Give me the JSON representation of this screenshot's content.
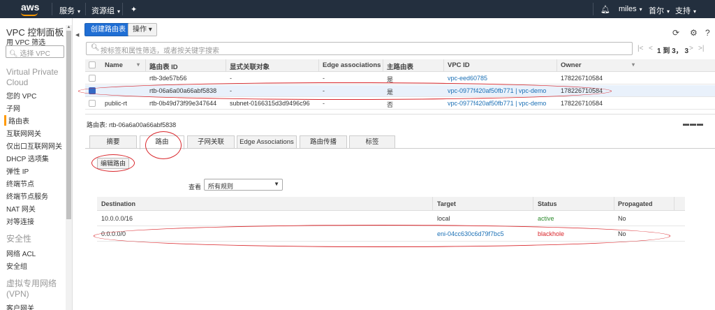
{
  "topnav": {
    "logo": "aws",
    "services": "服务",
    "resource_groups": "资源组",
    "user": "miles",
    "region": "首尔",
    "support": "支持"
  },
  "sidebar": {
    "title": "VPC 控制面板",
    "filter_label": "用 VPC 筛选",
    "filter_placeholder": "选择 VPC",
    "section_vpc": "Virtual Private Cloud",
    "items_vpc": [
      "您的 VPC",
      "子网",
      "路由表",
      "互联网网关",
      "仅出口互联网网关",
      "DHCP 选项集",
      "弹性 IP",
      "终端节点",
      "终端节点服务",
      "NAT 网关",
      "对等连接"
    ],
    "section_security": "安全性",
    "items_security": [
      "网络 ACL",
      "安全组"
    ],
    "section_vpn": "虚拟专用网络 (VPN)",
    "items_vpn": [
      "客户网关"
    ]
  },
  "toolbar": {
    "create_label": "创建路由表",
    "actions_label": "操作"
  },
  "search": {
    "placeholder": "按标签和属性筛选，或者按关键字搜索",
    "pager_text": "1 到 3， 3"
  },
  "route_tables": {
    "columns": [
      "Name",
      "路由表 ID",
      "显式关联对象",
      "Edge associations",
      "主路由表",
      "VPC ID",
      "Owner"
    ],
    "rows": [
      {
        "name": "",
        "id": "rtb-3de57b56",
        "explicit": "-",
        "edge": "-",
        "main": "是",
        "vpc": "vpc-eed60785",
        "owner": "178226710584",
        "selected": false
      },
      {
        "name": "",
        "id": "rtb-06a6a00a66abf5838",
        "explicit": "-",
        "edge": "-",
        "main": "是",
        "vpc": "vpc-0977f420af50fb771 | vpc-demo",
        "owner": "178226710584",
        "selected": true
      },
      {
        "name": "public-rt",
        "id": "rtb-0b49d73f99e347644",
        "explicit": "subnet-0166315d3d9496c96",
        "edge": "-",
        "main": "否",
        "vpc": "vpc-0977f420af50fb771 | vpc-demo",
        "owner": "178226710584",
        "selected": false
      }
    ]
  },
  "detail": {
    "title_label": "路由表:",
    "title_value": "rtb-06a6a00a66abf5838",
    "tabs": [
      "摘要",
      "路由",
      "子网关联",
      "Edge Associations",
      "路由传播",
      "标签"
    ],
    "active_tab": "路由",
    "edit_routes_label": "编辑路由",
    "view_label": "查看",
    "view_value": "所有规则"
  },
  "routes": {
    "columns": [
      "Destination",
      "Target",
      "Status",
      "Propagated"
    ],
    "rows": [
      {
        "destination": "10.0.0.0/16",
        "target": "local",
        "status": "active",
        "propagated": "No"
      },
      {
        "destination": "0.0.0.0/0",
        "target": "eni-04cc630c6d79f7bc5",
        "status": "blackhole",
        "propagated": "No"
      }
    ]
  },
  "colors": {
    "nav_bg": "#232f3e",
    "primary_button": "#1f6ed4",
    "link": "#1a6fb5",
    "active_status": "#2e8b2e",
    "blackhole_status": "#d9262b",
    "annotation": "#d9262b"
  }
}
